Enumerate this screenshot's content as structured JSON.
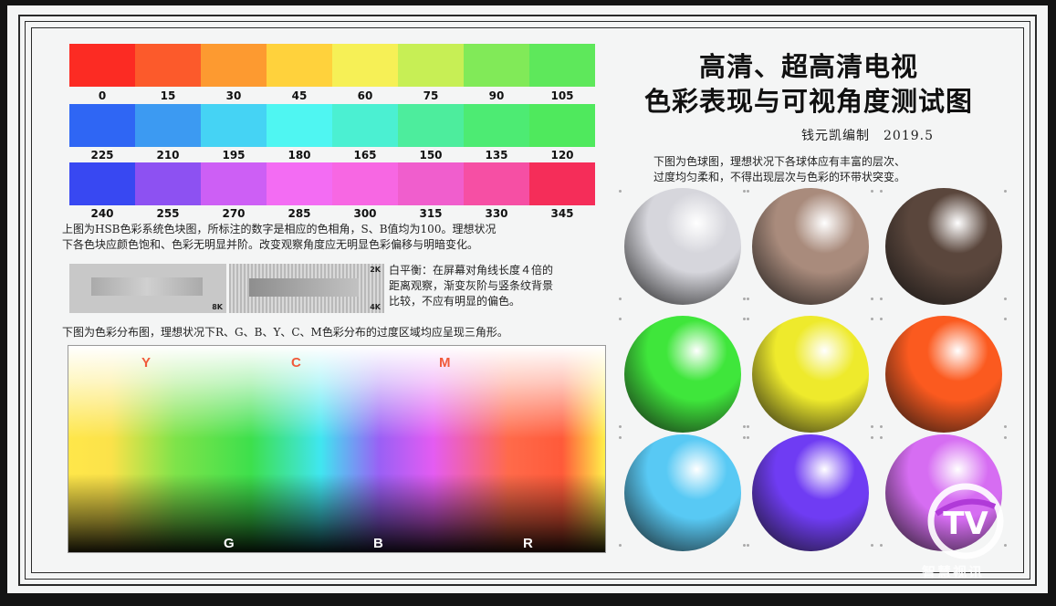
{
  "title_line1": "高清、超高清电视",
  "title_line2": "色彩表现与可视角度测试图",
  "author": "钱元凯编制　2019.5",
  "row1": {
    "labels": [
      "0",
      "15",
      "30",
      "45",
      "60",
      "75",
      "90",
      "105"
    ],
    "colors": [
      "#fc2b23",
      "#fc5a2b",
      "#fd9a30",
      "#ffd23c",
      "#f6f056",
      "#c7ef55",
      "#81ea58",
      "#5ee85b"
    ]
  },
  "row2": {
    "labels": [
      "225",
      "210",
      "195",
      "180",
      "165",
      "150",
      "135",
      "120"
    ],
    "colors": [
      "#2f66f4",
      "#3c9af2",
      "#45d3f4",
      "#4ff6f2",
      "#4bf0d2",
      "#4ded9d",
      "#4deb73",
      "#4fe95d"
    ]
  },
  "row3": {
    "labels": [
      "240",
      "255",
      "270",
      "285",
      "300",
      "315",
      "330",
      "345"
    ],
    "colors": [
      "#3848f2",
      "#8d51f2",
      "#cd5ff5",
      "#f36cf3",
      "#f767e3",
      "#f05ecd",
      "#f64fa4",
      "#f52d59"
    ]
  },
  "hsb_note_l1": "上图为HSB色彩系统色块图，所标注的数字是相应的色相角，S、B值均为100。理想状况",
  "hsb_note_l2": "下各色块应颜色饱和、色彩无明显并阶。改变观察角度应无明显色彩偏移与明暗变化。",
  "label_8k": "8K",
  "label_2k": "2K",
  "label_4k": "4K",
  "wb_note_l1": "白平衡：在屏幕对角线长度４倍的",
  "wb_note_l2": "距离观察，渐变灰阶与竖条纹背景",
  "wb_note_l3": "比较，不应有明显的偏色。",
  "dist_note": "下图为色彩分布图，理想状况下R、G、B、Y、C、M色彩分布的过度区域均应呈现三角形。",
  "dist_top": [
    "Y",
    "C",
    "M"
  ],
  "dist_bottom": [
    "G",
    "B",
    "R"
  ],
  "sphere_note_l1": "下图为色球图，理想状况下各球体应有丰富的层次、",
  "sphere_note_l2": "过度均匀柔和，不得出现层次与色彩的环带状突变。",
  "spheres": [
    "#d6d6dc",
    "#a98b7c",
    "#5a463c",
    "#3fe63b",
    "#eeea2c",
    "#fb5a1f",
    "#58c9f4",
    "#6f3cf3",
    "#d66df2"
  ],
  "logo_text": "TV",
  "logo_caption": "智慧视讯"
}
